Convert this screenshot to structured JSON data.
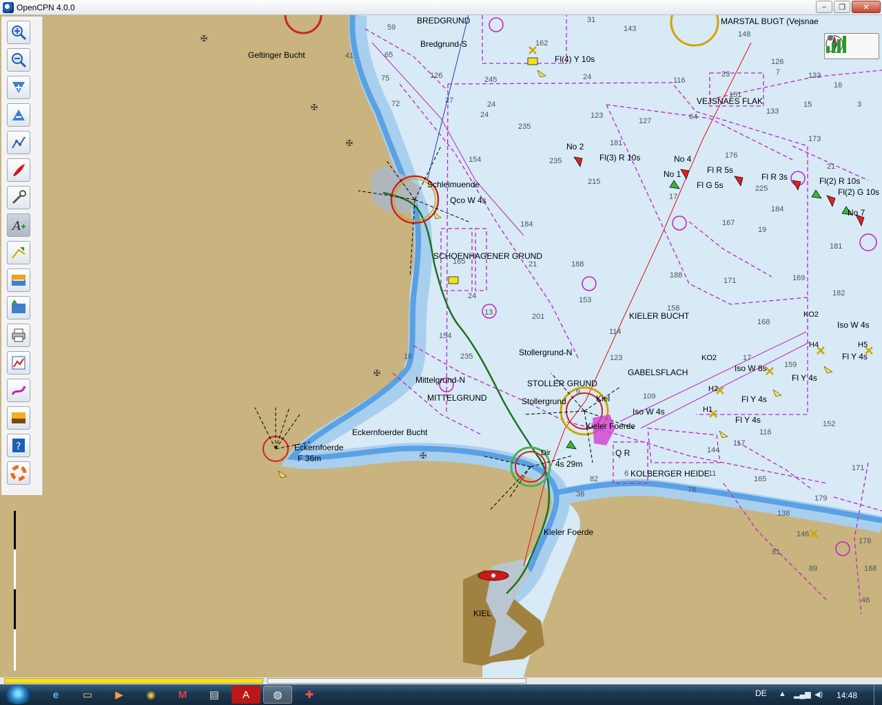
{
  "window": {
    "title": "OpenCPN 4.0.0",
    "minimize": "‒",
    "maximize": "❐",
    "close": "✕"
  },
  "toolbar": [
    {
      "name": "zoom-in-tool",
      "icon": "zoom-in-icon"
    },
    {
      "name": "zoom-out-tool",
      "icon": "zoom-out-icon"
    },
    {
      "name": "scale-in-tool",
      "icon": "scale-in-icon"
    },
    {
      "name": "scale-out-tool",
      "icon": "scale-out-icon"
    },
    {
      "name": "route-tool",
      "icon": "route-icon"
    },
    {
      "name": "auto-follow-tool",
      "icon": "ship-icon"
    },
    {
      "name": "settings-tool",
      "icon": "wrench-icon"
    },
    {
      "name": "text-toggle-tool",
      "icon": "text-icon"
    },
    {
      "name": "route-manager-tool",
      "icon": "route-manager-icon"
    },
    {
      "name": "tides-tool",
      "icon": "tides-icon"
    },
    {
      "name": "currents-tool",
      "icon": "currents-icon"
    },
    {
      "name": "print-tool",
      "icon": "printer-icon"
    },
    {
      "name": "track-tool",
      "icon": "track-icon"
    },
    {
      "name": "waypoint-tool",
      "icon": "waypoint-icon"
    },
    {
      "name": "color-scheme-tool",
      "icon": "sun-icon"
    },
    {
      "name": "help-tool",
      "icon": "help-icon"
    },
    {
      "name": "mob-tool",
      "icon": "lifebuoy-icon"
    }
  ],
  "labels": {
    "bredgrund": "BREDGRUND",
    "bredgrund_s": "Bredgrund-S",
    "marstal": "MARSTAL BUGT (Vejsnae",
    "geltinger": "Geltinger Bucht",
    "fl4y": "Fl(4) Y 10s",
    "vejsnaes": "VEJSNAES FLAK",
    "no2": "No 2",
    "fl3r": "Fl(3) R 10s",
    "no4": "No 4",
    "no1": "No 1",
    "flr5s": "Fl R 5s",
    "flg5s": "Fl G 5s",
    "flr3s": "Fl R 3s",
    "fl2r": "Fl(2) R 10s",
    "fl2g": "Fl(2) G 10s",
    "no7": "No 7",
    "schleimuende": "Schleimuende",
    "qcow": "Qco W 4s",
    "schoenhagener": "SCHOENHAGENER GRUND",
    "kieler_bucht": "KIELER BUCHT",
    "ko2a": "KO2",
    "isow4s_a": "Iso W 4s",
    "h5": "H5",
    "fly4s_a": "Fl Y 4s",
    "h4": "H4",
    "stollergrund_n": "Stollergrund-N",
    "stoller_grund": "STOLLER GRUND",
    "gabelsflach": "GABELSFLACH",
    "ko2b": "KO2",
    "isow8s": "Iso W 8s",
    "fly4s_b": "Fl Y 4s",
    "mittelgrund_n": "Mittelgrund-N",
    "mittelgrund": "MITTELGRUND",
    "stollergrund": "Stollergrund",
    "kiel": "Kiel",
    "h2": "H2",
    "fly4s_c": "Fl Y 4s",
    "isow4s_b": "Iso W 4s",
    "h1": "H1",
    "fly4s_d": "Fl Y 4s",
    "kieler_foerde_a": "Kieler Foerde",
    "eckernfoerder_bucht": "Eckernfoerder Bucht",
    "eckernfoerde": "Eckernfoerde",
    "f36m": "F 36m",
    "qr": "Q R",
    "kolberger": "KOLBERGER HEIDE",
    "dir": "Dir",
    "a29m": "4s 29m",
    "kieler_foerde_b": "Kieler Foerde",
    "kiel_city": "KIEL"
  },
  "depths": [
    {
      "t": "31"
    },
    {
      "t": "143"
    },
    {
      "t": "148"
    },
    {
      "t": "126"
    },
    {
      "t": "7"
    },
    {
      "t": "133"
    },
    {
      "t": "16"
    },
    {
      "t": "59"
    },
    {
      "t": "162"
    },
    {
      "t": "41"
    },
    {
      "t": "65"
    },
    {
      "t": "75"
    },
    {
      "t": "126"
    },
    {
      "t": "245"
    },
    {
      "t": "24"
    },
    {
      "t": "116"
    },
    {
      "t": "23"
    },
    {
      "t": "151"
    },
    {
      "t": "133"
    },
    {
      "t": "15"
    },
    {
      "t": "72"
    },
    {
      "t": "27"
    },
    {
      "t": "24"
    },
    {
      "t": "24"
    },
    {
      "t": "123"
    },
    {
      "t": "127"
    },
    {
      "t": "64"
    },
    {
      "t": "176"
    },
    {
      "t": "173"
    },
    {
      "t": "235"
    },
    {
      "t": "181"
    },
    {
      "t": "154"
    },
    {
      "t": "235"
    },
    {
      "t": "215"
    },
    {
      "t": "17"
    },
    {
      "t": "225"
    },
    {
      "t": "21"
    },
    {
      "t": "184"
    },
    {
      "t": "167"
    },
    {
      "t": "19"
    },
    {
      "t": "181"
    },
    {
      "t": "184"
    },
    {
      "t": "165"
    },
    {
      "t": "21"
    },
    {
      "t": "188"
    },
    {
      "t": "188"
    },
    {
      "t": "171"
    },
    {
      "t": "169"
    },
    {
      "t": "182"
    },
    {
      "t": "153"
    },
    {
      "t": "158"
    },
    {
      "t": "201"
    },
    {
      "t": "114"
    },
    {
      "t": "168"
    },
    {
      "t": "24"
    },
    {
      "t": "154"
    },
    {
      "t": "235"
    },
    {
      "t": "123"
    },
    {
      "t": "17"
    },
    {
      "t": "159"
    },
    {
      "t": "16"
    },
    {
      "t": "9"
    },
    {
      "t": "109"
    },
    {
      "t": "116"
    },
    {
      "t": "152"
    },
    {
      "t": "144"
    },
    {
      "t": "117"
    },
    {
      "t": "171"
    },
    {
      "t": "78"
    },
    {
      "t": "165"
    },
    {
      "t": "179"
    },
    {
      "t": "138"
    },
    {
      "t": "146"
    },
    {
      "t": "178"
    },
    {
      "t": "81"
    },
    {
      "t": "89"
    },
    {
      "t": "168"
    },
    {
      "t": "46"
    },
    {
      "t": "38"
    },
    {
      "t": "82"
    },
    {
      "t": "11"
    },
    {
      "t": "3"
    },
    {
      "t": "13"
    },
    {
      "t": "6"
    }
  ],
  "statusbar": {
    "left": "",
    "middle": ""
  },
  "taskbar": {
    "apps": [
      {
        "name": "taskbar-ie",
        "icon": "ie-icon",
        "glyph": "e"
      },
      {
        "name": "taskbar-explorer",
        "icon": "folder-icon",
        "glyph": "▭"
      },
      {
        "name": "taskbar-media",
        "icon": "media-icon",
        "glyph": "▶"
      },
      {
        "name": "taskbar-chrome",
        "icon": "chrome-icon",
        "glyph": "◉"
      },
      {
        "name": "taskbar-gmail",
        "icon": "mail-icon",
        "glyph": "M"
      },
      {
        "name": "taskbar-files",
        "icon": "files-icon",
        "glyph": "▤"
      },
      {
        "name": "taskbar-pdf",
        "icon": "pdf-icon",
        "glyph": "A"
      },
      {
        "name": "taskbar-opencpn",
        "icon": "opencpn-icon",
        "glyph": "◍"
      },
      {
        "name": "taskbar-app",
        "icon": "app-icon",
        "glyph": "✚"
      }
    ],
    "lang": "DE",
    "clock": "14:48"
  },
  "colors": {
    "land": "#c9b37f",
    "deep_water": "#d7eaf6",
    "shallow": "#a9cfee",
    "very_shallow": "#5aa1e3",
    "route": "#1c6f1c",
    "restricted": "#c020c0"
  }
}
